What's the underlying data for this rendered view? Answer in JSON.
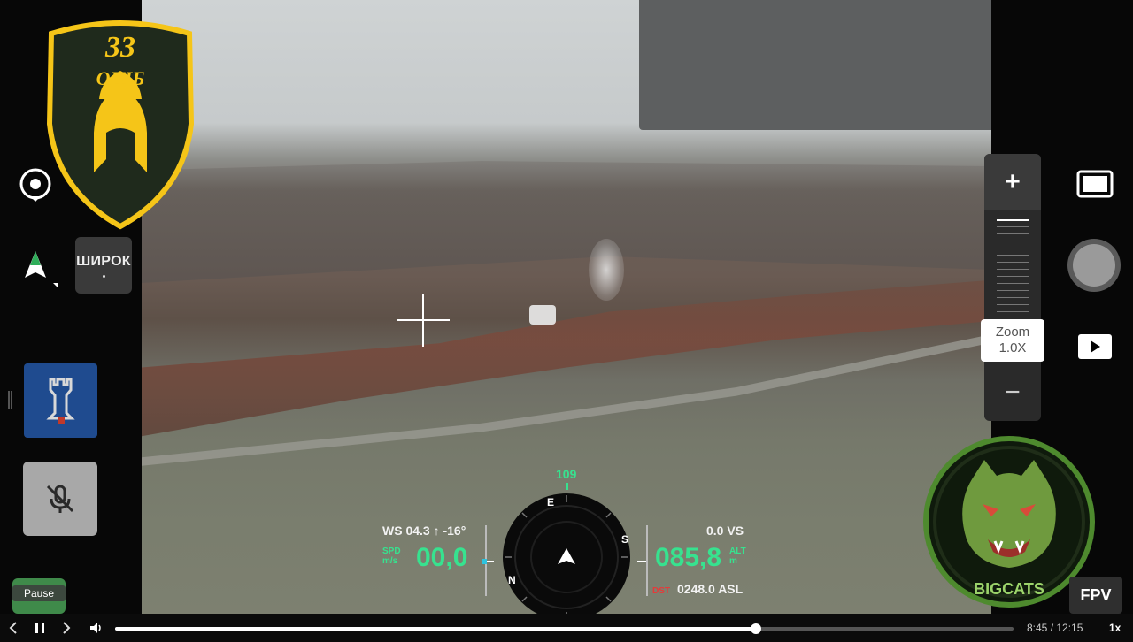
{
  "left_controls": {
    "wide_button_label": "ШИРОК",
    "wide_button_indicator": ".",
    "pause_tooltip": "Pause"
  },
  "logos": {
    "unit_badge_text_1": "33",
    "unit_badge_text_2": "ОШБ",
    "bigcats_text": "BIGCATS"
  },
  "zoom": {
    "plus": "+",
    "minus": "−",
    "label": "Zoom",
    "value": "1.0X"
  },
  "right_controls": {
    "fpv_label": "FPV"
  },
  "hud": {
    "heading": "109",
    "wind": "WS 04.3 ↑  -16°",
    "speed_label_1": "SPD",
    "speed_label_2": "m/s",
    "speed_value": "00,0",
    "vs": "0.0  VS",
    "altitude_value": "085,8",
    "altitude_label_1": "ALT",
    "altitude_label_2": "m",
    "dst_label": "DST",
    "asl": "0248.0 ASL",
    "compass_marks": [
      "E",
      "S",
      "N"
    ]
  },
  "video_bar": {
    "time": "8:45 / 12:15",
    "speed": "1x",
    "progress": 0.713
  },
  "colors": {
    "hud_green": "#37e28f",
    "hud_red": "#e53a3a",
    "badge_yellow": "#f5c518",
    "badge_dark": "#1f2a1c",
    "bigcats_green": "#4e8a2e"
  }
}
